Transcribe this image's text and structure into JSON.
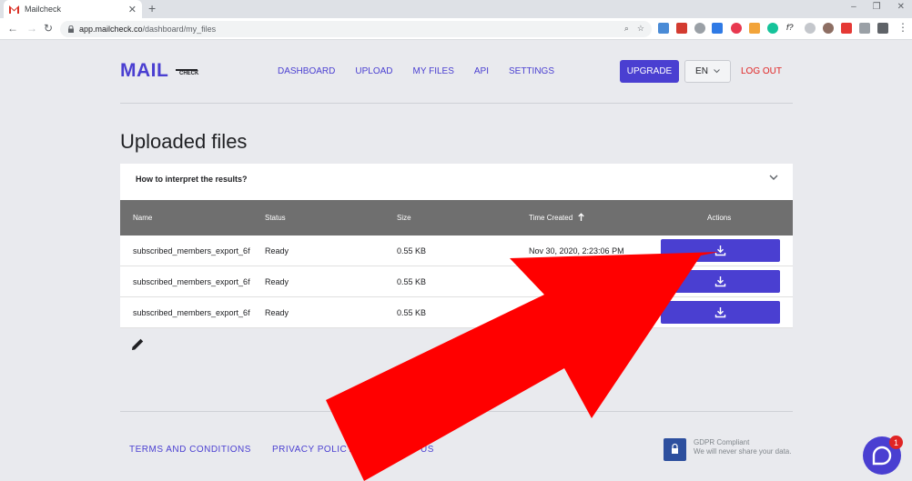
{
  "browser": {
    "tab_title": "Mailcheck",
    "url_host": "app.mailcheck.co",
    "url_path": "/dashboard/my_files",
    "new_tab": "+",
    "tab_close": "✕",
    "window_controls": [
      "–",
      "❐",
      "✕"
    ]
  },
  "header": {
    "logo_text": "MAIL",
    "logo_sub": "CHECK",
    "nav": [
      "DASHBOARD",
      "UPLOAD",
      "MY FILES",
      "API",
      "SETTINGS"
    ],
    "upgrade": "UPGRADE",
    "language": "EN",
    "logout": "LOG OUT"
  },
  "main": {
    "title": "Uploaded files",
    "accordion_question": "How to interpret the results?",
    "table": {
      "headers": [
        "Name",
        "Status",
        "Size",
        "Time Created",
        "Actions"
      ],
      "rows": [
        {
          "name": "subscribed_members_export_6f",
          "status": "Ready",
          "size": "0.55 KB",
          "time": "Nov 30, 2020, 2:23:06 PM"
        },
        {
          "name": "subscribed_members_export_6f",
          "status": "Ready",
          "size": "0.55 KB",
          "time": ""
        },
        {
          "name": "subscribed_members_export_6f",
          "status": "Ready",
          "size": "0.55 KB",
          "time": ""
        }
      ]
    }
  },
  "footer": {
    "links": [
      "TERMS AND CONDITIONS",
      "PRIVACY POLICY",
      "US"
    ],
    "gdpr_title": "GDPR Compliant",
    "gdpr_sub": "We will never share your data."
  },
  "chat": {
    "badge_count": "1"
  },
  "colors": {
    "accent": "#4a3fd1",
    "logout": "#e02424",
    "arrow": "#ff0000",
    "table_header": "#6f6f6f"
  }
}
